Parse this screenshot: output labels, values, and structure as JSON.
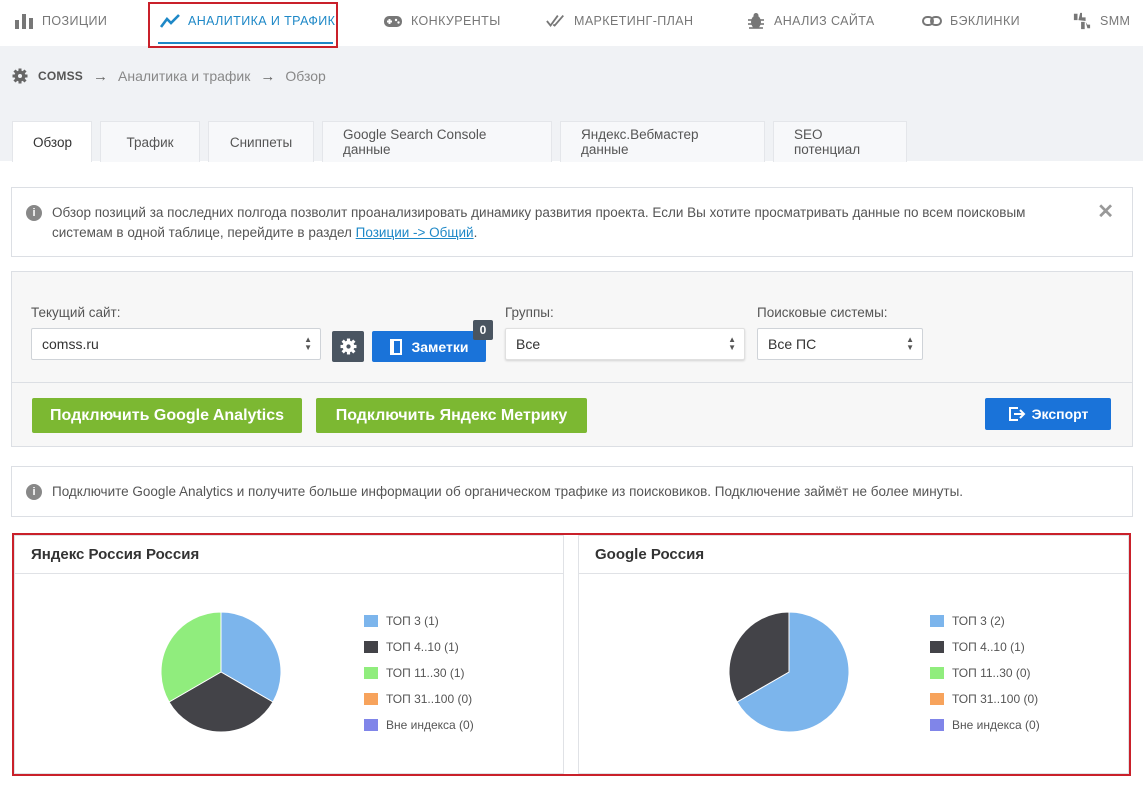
{
  "nav": {
    "items": [
      {
        "label": "Позиции",
        "icon": "bar-chart-icon"
      },
      {
        "label": "Аналитика и трафик",
        "icon": "trend-line-icon",
        "active": true
      },
      {
        "label": "Конкуренты",
        "icon": "gamepad-icon"
      },
      {
        "label": "Маркетинг-план",
        "icon": "double-check-icon"
      },
      {
        "label": "Анализ сайта",
        "icon": "bug-icon"
      },
      {
        "label": "Бэклинки",
        "icon": "link-icon"
      },
      {
        "label": "SMM",
        "icon": "thumbs-icon"
      }
    ]
  },
  "breadcrumb": {
    "site": "COMSS",
    "section": "Аналитика и трафик",
    "page": "Обзор"
  },
  "tabs": [
    {
      "label": "Обзор",
      "active": true
    },
    {
      "label": "Трафик"
    },
    {
      "label": "Сниппеты"
    },
    {
      "label": "Google Search Console данные"
    },
    {
      "label": "Яндекс.Вебмастер данные"
    },
    {
      "label": "SEO потенциал"
    }
  ],
  "notice1": {
    "text": "Обзор позиций за последних полгода позволит проанализировать динамику развития проекта. Если Вы хотите просматривать данные по всем поисковым системам в одной таблице, перейдите в раздел ",
    "link": "Позиции -> Общий",
    "suffix": "."
  },
  "filters": {
    "site_label": "Текущий сайт:",
    "site_value": "comss.ru",
    "notes_label": "Заметки",
    "notes_count": "0",
    "groups_label": "Группы:",
    "groups_value": "Все",
    "engines_label": "Поисковые системы:",
    "engines_value": "Все ПС",
    "connect_ga": "Подключить Google Analytics",
    "connect_ym": "Подключить Яндекс Метрику",
    "export": "Экспорт"
  },
  "notice2": {
    "text": "Подключите Google Analytics и получите больше информации об органическом трафике из поисковиков. Подключение займёт не более минуты."
  },
  "colors": {
    "top3": "#7cb5ec",
    "top4_10": "#434348",
    "top11_30": "#90ed7d",
    "top31_100": "#f7a35c",
    "out": "#8085e9"
  },
  "chart_data": [
    {
      "type": "pie",
      "title": "Яндекс Россия Россия",
      "categories": [
        "ТОП 3",
        "ТОП 4..10",
        "ТОП 11..30",
        "ТОП 31..100",
        "Вне индекса"
      ],
      "values": [
        1,
        1,
        1,
        0,
        0
      ],
      "legend": [
        "ТОП 3 (1)",
        "ТОП 4..10 (1)",
        "ТОП 11..30 (1)",
        "ТОП 31..100 (0)",
        "Вне индекса (0)"
      ]
    },
    {
      "type": "pie",
      "title": "Google Россия",
      "categories": [
        "ТОП 3",
        "ТОП 4..10",
        "ТОП 11..30",
        "ТОП 31..100",
        "Вне индекса"
      ],
      "values": [
        2,
        1,
        0,
        0,
        0
      ],
      "legend": [
        "ТОП 3 (2)",
        "ТОП 4..10 (1)",
        "ТОП 11..30 (0)",
        "ТОП 31..100 (0)",
        "Вне индекса (0)"
      ]
    }
  ]
}
